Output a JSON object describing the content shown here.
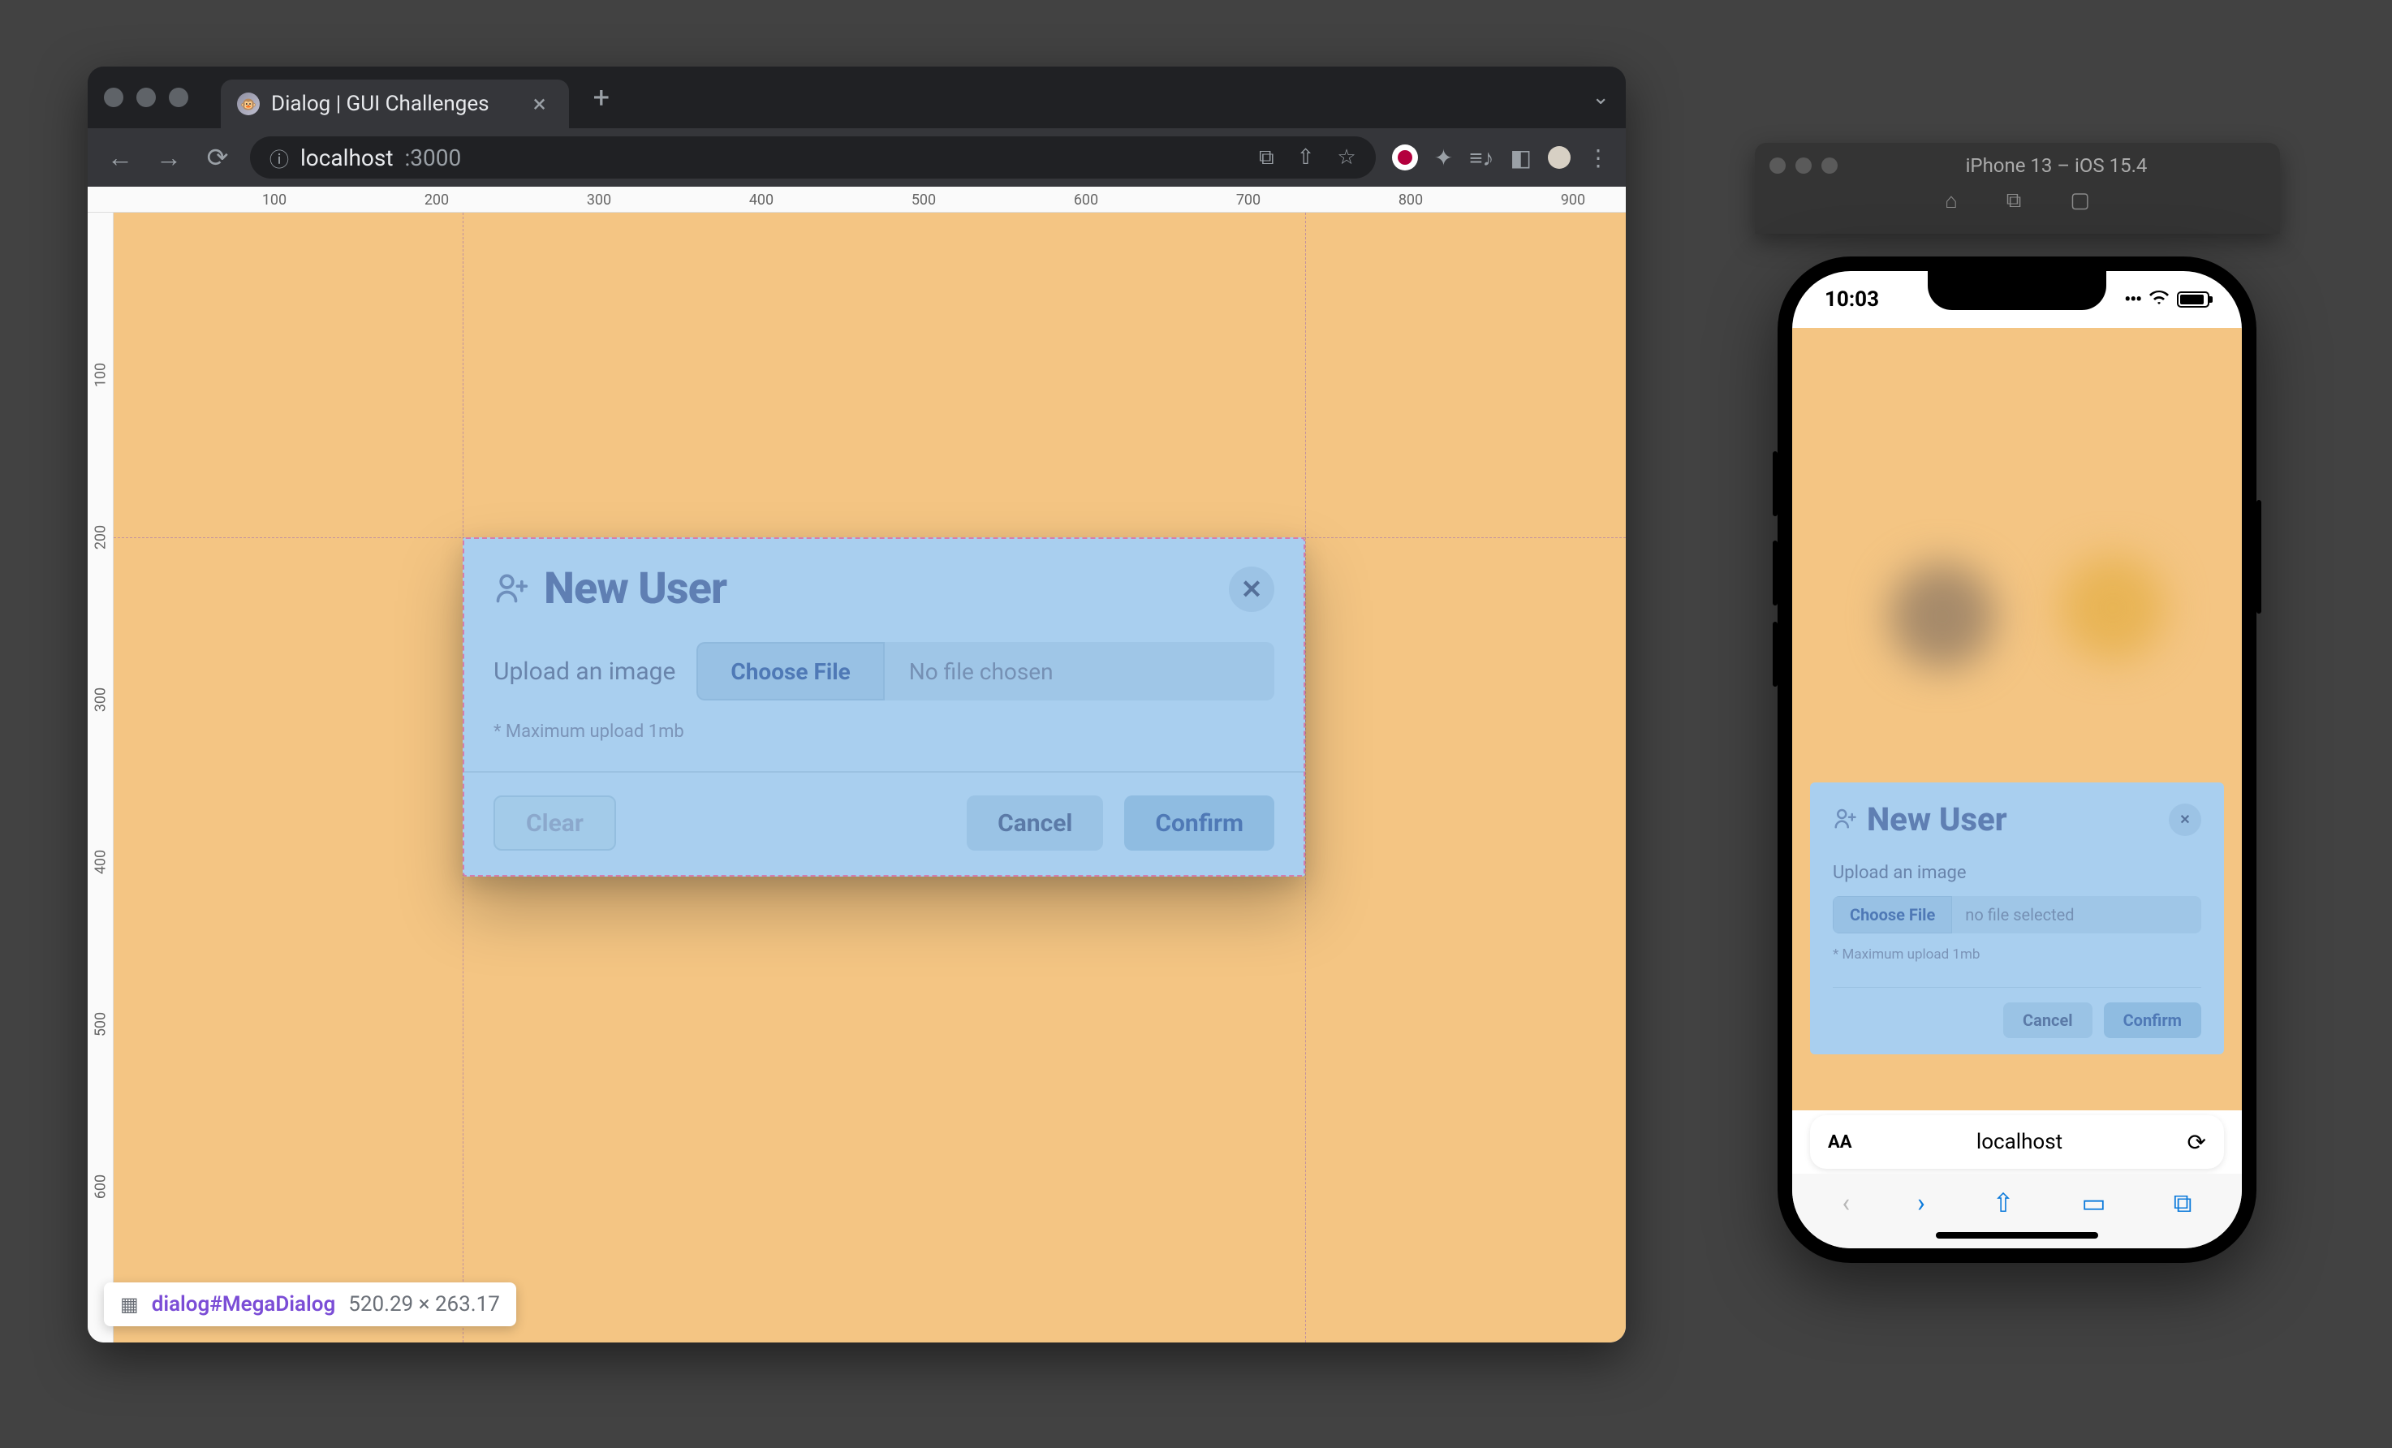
{
  "browser": {
    "tab_title": "Dialog | GUI Challenges",
    "address": {
      "host": "localhost",
      "path": ":3000"
    }
  },
  "rulers": {
    "h": [
      "100",
      "200",
      "300",
      "400",
      "500",
      "600",
      "700",
      "800",
      "900"
    ],
    "v": [
      "100",
      "200",
      "300",
      "400",
      "500",
      "600"
    ]
  },
  "dialog": {
    "title": "New User",
    "upload_label": "Upload an image",
    "choose_label": "Choose File",
    "file_status": "No file chosen",
    "hint": "* Maximum upload 1mb",
    "buttons": {
      "clear": "Clear",
      "cancel": "Cancel",
      "confirm": "Confirm"
    }
  },
  "devtools_badge": {
    "selector": "dialog#MegaDialog",
    "dimensions": "520.29 × 263.17"
  },
  "simulator": {
    "title": "iPhone 13 – iOS 15.4",
    "status_time": "10:03",
    "safari_url": "localhost",
    "dialog": {
      "title": "New User",
      "upload_label": "Upload an image",
      "choose_label": "Choose File",
      "file_status": "no file selected",
      "hint": "* Maximum upload 1mb",
      "buttons": {
        "cancel": "Cancel",
        "confirm": "Confirm"
      }
    }
  }
}
